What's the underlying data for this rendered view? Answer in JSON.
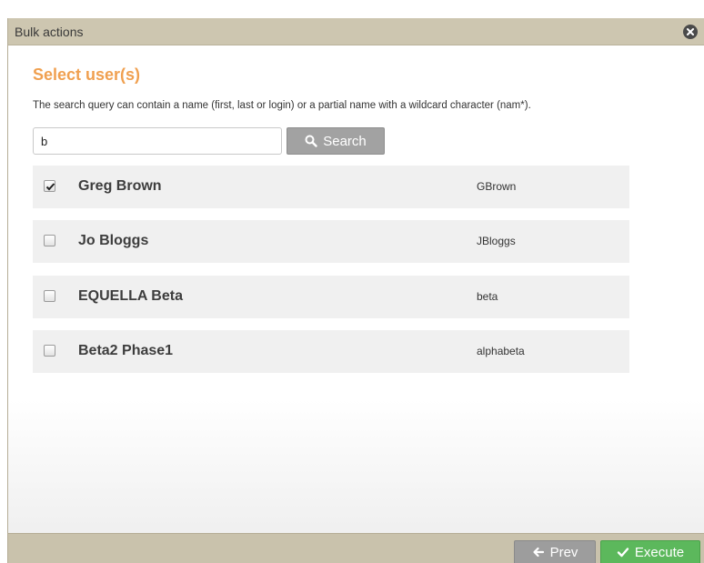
{
  "dialog": {
    "title": "Bulk actions",
    "heading": "Select user(s)",
    "hint": "The search query can contain a name (first, last or login) or a partial name with a wildcard character (nam*)."
  },
  "search": {
    "value": "b",
    "button_label": "Search",
    "icon": "search-icon"
  },
  "users": [
    {
      "name": "Greg Brown",
      "login": "GBrown",
      "checked": true
    },
    {
      "name": "Jo Bloggs",
      "login": "JBloggs",
      "checked": false
    },
    {
      "name": "EQUELLA Beta",
      "login": "beta",
      "checked": false
    },
    {
      "name": "Beta2 Phase1",
      "login": "alphabeta",
      "checked": false
    }
  ],
  "footer": {
    "prev_label": "Prev",
    "execute_label": "Execute"
  },
  "colors": {
    "accent_heading": "#f0a050",
    "execute": "#5cb85c",
    "titlebar": "#cdc6b0"
  }
}
